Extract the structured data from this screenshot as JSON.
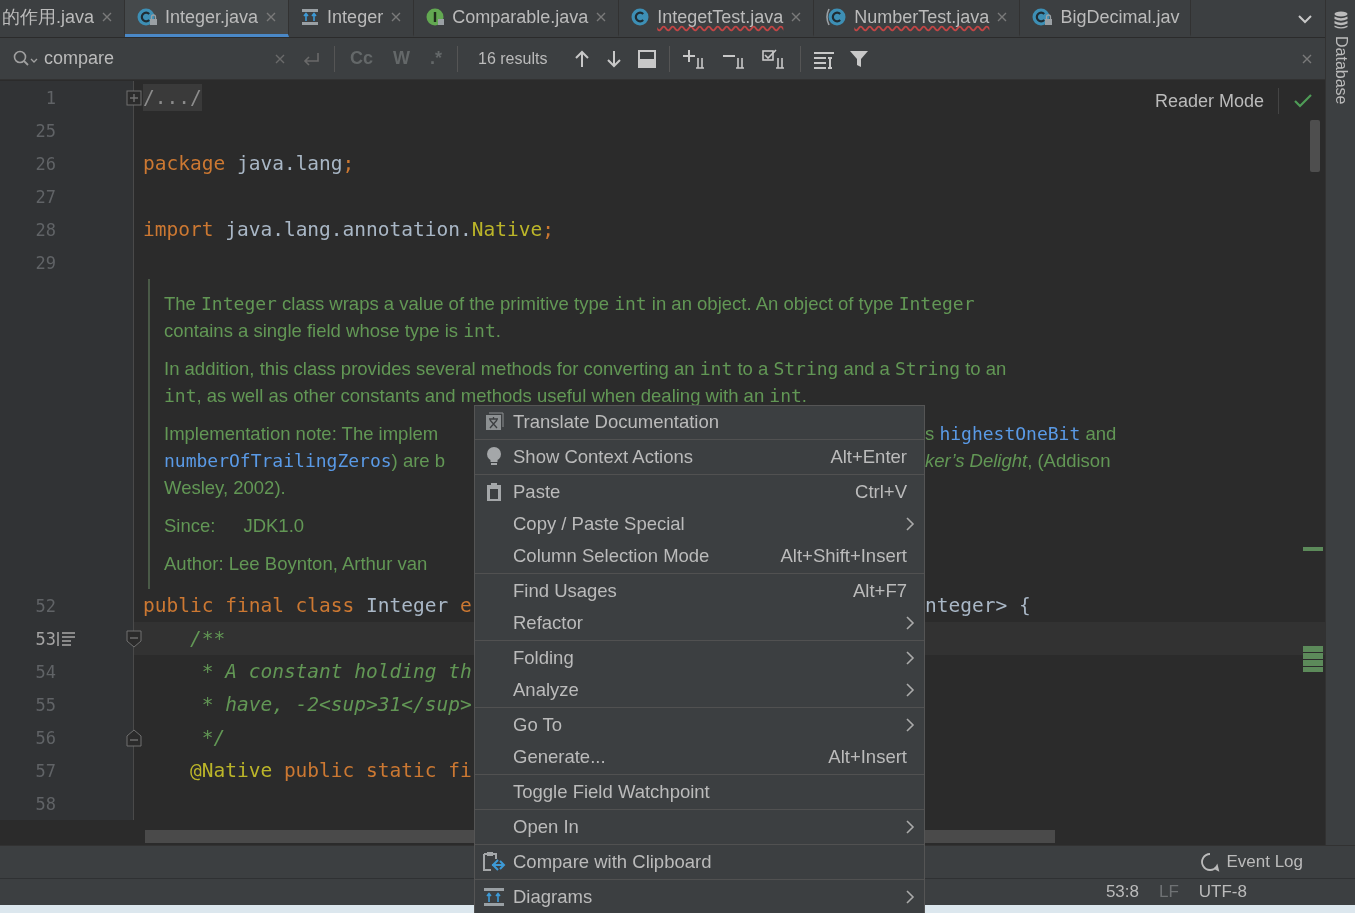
{
  "tabs": [
    {
      "label": "的作用.java",
      "kind": "none",
      "selected": false,
      "error": false,
      "closable": true
    },
    {
      "label": "Integer.java",
      "kind": "locked_class",
      "selected": true,
      "error": false,
      "closable": true
    },
    {
      "label": "Integer",
      "kind": "diagram",
      "selected": false,
      "error": false,
      "closable": true
    },
    {
      "label": "Comparable.java",
      "kind": "interface",
      "selected": false,
      "error": false,
      "closable": true
    },
    {
      "label": "IntegetTest.java",
      "kind": "class",
      "selected": false,
      "error": true,
      "closable": true
    },
    {
      "label": "NumberTest.java",
      "kind": "bracketed_class",
      "selected": false,
      "error": true,
      "closable": true
    },
    {
      "label": "BigDecimal.jav",
      "kind": "locked_class",
      "selected": false,
      "error": false,
      "closable": false
    }
  ],
  "find": {
    "query": "compare",
    "options": [
      {
        "label": "Cc",
        "selected": false
      },
      {
        "label": "W",
        "selected": false
      },
      {
        "label": ".*",
        "selected": false
      }
    ],
    "results": "16 results"
  },
  "reader_mode": {
    "label": "Reader Mode"
  },
  "editor": {
    "lines": [
      {
        "kind": "folded",
        "number": "1",
        "current": false,
        "left": [
          {
            "text": "/.../",
            "kind": "placeholder"
          }
        ]
      },
      {
        "kind": "code",
        "number": "25",
        "current": false
      },
      {
        "kind": "code",
        "number": "26",
        "current": false,
        "left": [
          {
            "text": "package",
            "kind": "keyword"
          },
          {
            "text": " java.lang",
            "kind": "identifier"
          },
          {
            "text": ";",
            "kind": "keyword"
          }
        ]
      },
      {
        "kind": "code",
        "number": "27",
        "current": false
      },
      {
        "kind": "code",
        "number": "28",
        "current": false,
        "left": [
          {
            "text": "import",
            "kind": "keyword"
          },
          {
            "text": " java.lang.annotation.",
            "kind": "identifier"
          },
          {
            "text": "Native",
            "kind": "annotation"
          },
          {
            "text": ";",
            "kind": "keyword"
          }
        ]
      },
      {
        "kind": "code",
        "number": "29",
        "current": false
      },
      {
        "kind": "doc",
        "paragraphs": [
          {
            "lines": [
              {
                "left": [
                  {
                    "text": "The ",
                    "kind": "prose"
                  },
                  {
                    "text": "Integer",
                    "kind": "code"
                  },
                  {
                    "text": " class wraps a value of the primitive type ",
                    "kind": "prose"
                  },
                  {
                    "text": "int",
                    "kind": "code"
                  },
                  {
                    "text": " in an object. An object of type ",
                    "kind": "prose"
                  },
                  {
                    "text": "Integer",
                    "kind": "code"
                  }
                ]
              },
              {
                "left": [
                  {
                    "text": "contains a single field whose type is ",
                    "kind": "prose"
                  },
                  {
                    "text": "int",
                    "kind": "code"
                  },
                  {
                    "text": ".",
                    "kind": "prose"
                  }
                ]
              }
            ]
          },
          {
            "lines": [
              {
                "left": [
                  {
                    "text": "In addition, this class provides several methods for converting an ",
                    "kind": "prose"
                  },
                  {
                    "text": "int",
                    "kind": "code"
                  },
                  {
                    "text": " to a ",
                    "kind": "prose"
                  },
                  {
                    "text": "String",
                    "kind": "code"
                  },
                  {
                    "text": " and a ",
                    "kind": "prose"
                  },
                  {
                    "text": "String",
                    "kind": "code"
                  },
                  {
                    "text": " to an",
                    "kind": "prose"
                  }
                ]
              },
              {
                "left": [
                  {
                    "text": "int",
                    "kind": "code"
                  },
                  {
                    "text": ", as well as other constants and methods useful when dealing with an ",
                    "kind": "prose"
                  },
                  {
                    "text": "int",
                    "kind": "code"
                  },
                  {
                    "text": ".",
                    "kind": "prose"
                  }
                ]
              }
            ]
          },
          {
            "lines": [
              {
                "left": [
                  {
                    "text": "Implementation note: The implem",
                    "kind": "prose"
                  }
                ],
                "right": [
                  {
                    "text": "s ",
                    "kind": "prose"
                  },
                  {
                    "text": "highestOneBit",
                    "kind": "link"
                  },
                  {
                    "text": " and",
                    "kind": "prose"
                  }
                ]
              },
              {
                "left": [
                  {
                    "text": "numberOfTrailingZeros",
                    "kind": "link"
                  },
                  {
                    "text": ") are b",
                    "kind": "prose"
                  }
                ],
                "right": [
                  {
                    "text": "ker’s Delight",
                    "kind": "title"
                  },
                  {
                    "text": ", (Addison",
                    "kind": "prose"
                  }
                ]
              },
              {
                "left": [
                  {
                    "text": "Wesley, 2002).",
                    "kind": "prose"
                  }
                ]
              }
            ]
          },
          {
            "lines": [
              {
                "left": [
                  {
                    "text": "Since:",
                    "kind": "prose"
                  },
                  {
                    "text": "JDK1.0",
                    "kind": "tagvalue"
                  }
                ]
              }
            ]
          },
          {
            "lines": [
              {
                "left": [
                  {
                    "text": "Author: Lee Boynton, Arthur van",
                    "kind": "prose"
                  }
                ]
              }
            ]
          }
        ]
      },
      {
        "kind": "code",
        "number": "52",
        "current": false,
        "left": [
          {
            "text": "public final class ",
            "kind": "keyword"
          },
          {
            "text": "Integer",
            "kind": "identifier"
          },
          {
            "text": " e",
            "kind": "keyword"
          }
        ],
        "right": [
          {
            "text": "nteger> {",
            "kind": "identifier"
          }
        ]
      },
      {
        "kind": "fold_start",
        "number": "53",
        "current": true,
        "left": [
          {
            "text": "    /**",
            "kind": "comment"
          }
        ]
      },
      {
        "kind": "code",
        "number": "54",
        "current": false,
        "left": [
          {
            "text": "     * A constant holding th",
            "kind": "comment"
          }
        ]
      },
      {
        "kind": "code",
        "number": "55",
        "current": false,
        "left": [
          {
            "text": "     * have, -2<sup>31</sup>",
            "kind": "comment"
          }
        ]
      },
      {
        "kind": "fold_end",
        "number": "56",
        "current": false,
        "left": [
          {
            "text": "     */",
            "kind": "comment"
          }
        ]
      },
      {
        "kind": "code",
        "number": "57",
        "current": false,
        "left": [
          {
            "text": "    @Native",
            "kind": "annotation"
          },
          {
            "text": " public static fi",
            "kind": "keyword"
          }
        ]
      },
      {
        "kind": "code",
        "number": "58",
        "current": false
      }
    ]
  },
  "menu": {
    "items": [
      {
        "label": "Translate Documentation",
        "kind": "translate",
        "separator_after": true,
        "submenu": false
      },
      {
        "label": "Show Context Actions",
        "kind": "bulb",
        "shortcut": "Alt+Enter",
        "separator_after": true,
        "submenu": false
      },
      {
        "label": "Paste",
        "kind": "paste",
        "shortcut": "Ctrl+V",
        "separator_after": false,
        "submenu": false
      },
      {
        "label": "Copy / Paste Special",
        "kind": "plain",
        "separator_after": false,
        "submenu": true
      },
      {
        "label": "Column Selection Mode",
        "kind": "plain",
        "shortcut": "Alt+Shift+Insert",
        "separator_after": true,
        "submenu": false
      },
      {
        "label": "Find Usages",
        "kind": "plain",
        "shortcut": "Alt+F7",
        "separator_after": false,
        "submenu": false
      },
      {
        "label": "Refactor",
        "kind": "plain",
        "separator_after": true,
        "submenu": true
      },
      {
        "label": "Folding",
        "kind": "plain",
        "separator_after": false,
        "submenu": true
      },
      {
        "label": "Analyze",
        "kind": "plain",
        "separator_after": true,
        "submenu": true
      },
      {
        "label": "Go To",
        "kind": "plain",
        "separator_after": false,
        "submenu": true
      },
      {
        "label": "Generate...",
        "kind": "plain",
        "shortcut": "Alt+Insert",
        "separator_after": true,
        "submenu": false
      },
      {
        "label": "Toggle Field Watchpoint",
        "kind": "plain",
        "separator_after": true,
        "submenu": false
      },
      {
        "label": "Open In",
        "kind": "plain",
        "separator_after": true,
        "submenu": true
      },
      {
        "label": "Compare with Clipboard",
        "kind": "compare",
        "separator_after": true,
        "submenu": false
      },
      {
        "label": "Diagrams",
        "kind": "diagram",
        "separator_after": false,
        "submenu": true
      }
    ]
  },
  "side_strip": {
    "label": "Database"
  },
  "tool_strip": {
    "event_log": "Event Log"
  },
  "status": {
    "items": [
      {
        "text": "53:8",
        "kind": "normal"
      },
      {
        "text": "LF",
        "kind": "dim"
      },
      {
        "text": "UTF-8",
        "kind": "normal"
      }
    ]
  }
}
